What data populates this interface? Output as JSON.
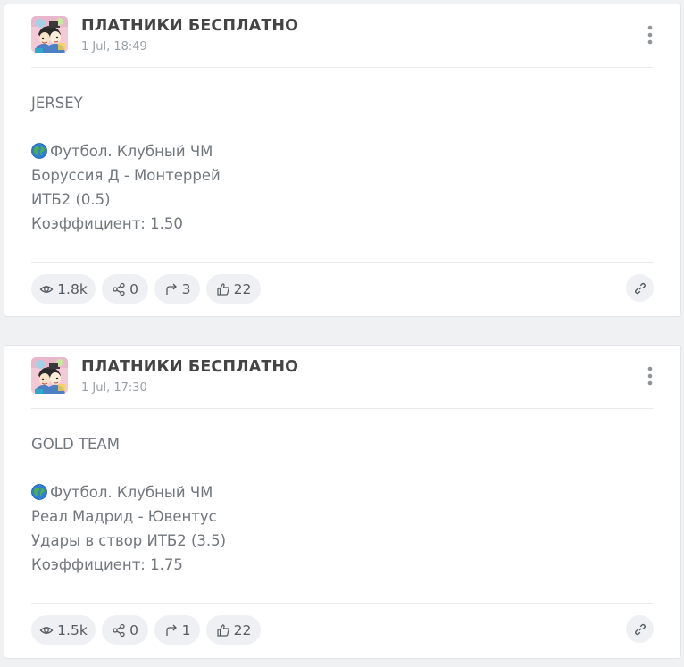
{
  "posts": [
    {
      "channel_name": "ПЛАТНИКИ БЕСПЛАТНО",
      "time": "1 Jul, 18:49",
      "avatar_icon": "channel-avatar",
      "lines": {
        "team": "JERSEY",
        "sport": "Футбол. Клубный ЧМ",
        "match": "Боруссия Д - Монтеррей",
        "bet": "ИТБ2 (0.5)",
        "odds": "Коэффициент: 1.50"
      },
      "stats": {
        "views": "1.8k",
        "shares": "0",
        "forwards": "3",
        "reactions": "22"
      }
    },
    {
      "channel_name": "ПЛАТНИКИ БЕСПЛАТНО",
      "time": "1 Jul, 17:30",
      "avatar_icon": "channel-avatar",
      "lines": {
        "team": "GOLD TEAM",
        "sport": "Футбол. Клубный ЧМ",
        "match": "Реал Мадрид - Ювентус",
        "bet": "Удары в створ ИТБ2 (3.5)",
        "odds": "Коэффициент: 1.75"
      },
      "stats": {
        "views": "1.5k",
        "shares": "0",
        "forwards": "1",
        "reactions": "22"
      }
    }
  ],
  "icons": {
    "globe": "globe-icon",
    "views": "eye-icon",
    "shares": "share-icon",
    "forwards": "forward-arrow-icon",
    "reactions": "thumbs-up-icon",
    "link": "link-icon",
    "menu": "more-vertical-icon"
  },
  "colors": {
    "background": "#f0f1f3",
    "card": "#ffffff",
    "title": "#444444",
    "text": "#72777d",
    "meta": "#9aa0a6",
    "pill": "#eef0f3"
  }
}
